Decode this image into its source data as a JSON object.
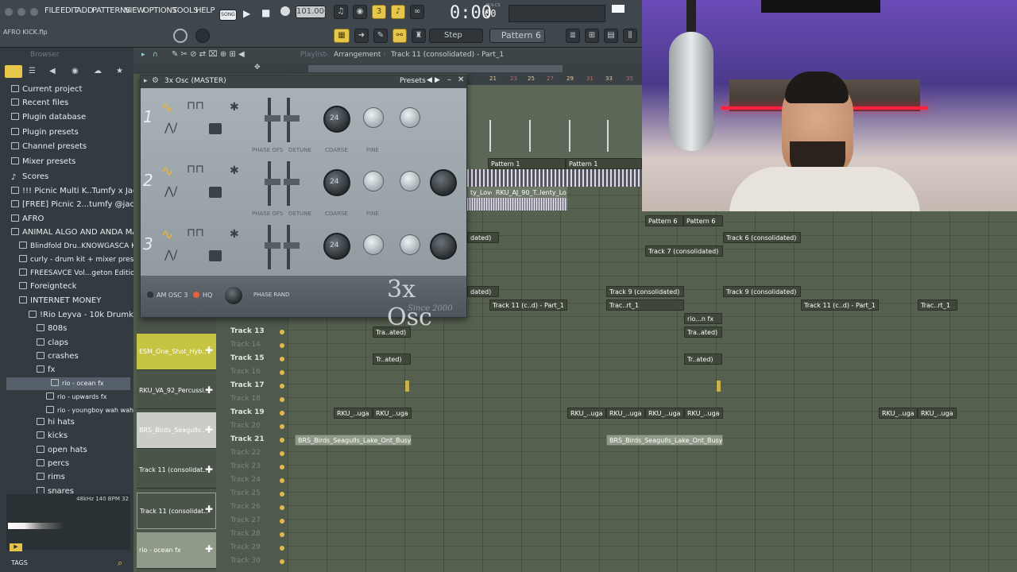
{
  "menu": {
    "items": [
      "FILE",
      "EDIT",
      "ADD",
      "PATTERNS",
      "VIEW",
      "OPTIONS",
      "TOOLS",
      "HELP"
    ],
    "song_label": "SONG",
    "tempo": "101.000",
    "time": "0:00",
    "time_sub": "00",
    "time_unit": "M:S:CS",
    "step_label": "Step",
    "pattern_label": "Pattern 6",
    "hint": "AFRO KICK.flp"
  },
  "browser": {
    "label": "Browser",
    "items": [
      {
        "label": "Current project"
      },
      {
        "label": "Recent files"
      },
      {
        "label": "Plugin database"
      },
      {
        "label": "Plugin presets"
      },
      {
        "label": "Channel presets"
      },
      {
        "label": "Mixer presets"
      },
      {
        "label": "Scores"
      },
      {
        "label": "!!! Picnic Multi K..Tumfy x Jacobvj)"
      },
      {
        "label": "[FREE] Picnic 2...tumfy @jacobvj1)"
      },
      {
        "label": "AFRO"
      },
      {
        "label": "ANIMAL ALGO AND ANDA MAL"
      },
      {
        "label": "Blindfold Dru..KNOWGASCA KIT"
      },
      {
        "label": "curly - drum kit + mixer presets"
      },
      {
        "label": "FREESAVCE Vol...geton Edition)"
      },
      {
        "label": "Foreignteck"
      },
      {
        "label": "INTERNET MONEY"
      },
      {
        "label": "!Rio Leyva - 10k Drumkit"
      },
      {
        "label": "808s"
      },
      {
        "label": "claps"
      },
      {
        "label": "crashes"
      },
      {
        "label": "fx"
      },
      {
        "label": "rio - ocean fx"
      },
      {
        "label": "rio - upwards fx"
      },
      {
        "label": "rio - youngboy wah wah fx"
      },
      {
        "label": "hi hats"
      },
      {
        "label": "kicks"
      },
      {
        "label": "open hats"
      },
      {
        "label": "percs"
      },
      {
        "label": "rims"
      },
      {
        "label": "snares"
      }
    ],
    "sample_info": "48kHz 140 BPM 32",
    "tags": "TAGS"
  },
  "playlist": {
    "title": "Playlist",
    "breadcrumb": "Arrangement",
    "sep": "›",
    "current": "Track 11 (consolidated) - Part_1",
    "ruler": [
      "19",
      "21",
      "23",
      "25",
      "27",
      "29",
      "31",
      "33",
      "35"
    ],
    "tracks": [
      "Track 13",
      "Track 14",
      "Track 15",
      "Track 16",
      "Track 17",
      "Track 18",
      "Track 19",
      "Track 20",
      "Track 21",
      "Track 22",
      "Track 23",
      "Track 24",
      "Track 25",
      "Track 26",
      "Track 27",
      "Track 28",
      "Track 29",
      "Track 30"
    ],
    "channels": [
      "ESM_One_Shot_Hyb..",
      "RKU_VA_92_Percussi..",
      "BRS_Birds_Seagulls..",
      "Track 11 (consolidat..",
      "Track 11 (consolidat..",
      "rio - ocean fx"
    ],
    "clips": {
      "pattern1": "Pattern 1",
      "pattern6": "Pattern 6",
      "dated": "dated)",
      "track6": "Track 6 (consolidated)",
      "track7": "Track 7 (consolidated)",
      "track9": "Track 9 (consolidated)",
      "track11cd": "Track 11 (c..d) - Part_1",
      "tracrt": "Trac..rt_1",
      "rioofx": "rio...n fx",
      "traated": "Tra..ated)",
      "trated": "Tr..ated)",
      "rku": "RKU_..uga",
      "brs": "BRS_Birds_Seagulls_Lake_Ont_Busy",
      "love1": "ty_Love",
      "love2": "RKU_AJ_90_T..lenty_Love"
    }
  },
  "osc": {
    "title": "3x Osc (MASTER)",
    "presets": "Presets",
    "name": "3x Osc",
    "since": "Since 2000",
    "numbers": [
      "1",
      "2",
      "3"
    ],
    "phase_ofs": "PHASE OFS",
    "detune": "DETUNE",
    "coarse": "COARSE",
    "fine": "FINE",
    "knob_val": "24",
    "am": "AM OSC 3",
    "hq": "HQ",
    "phase_rand": "PHASE RAND"
  }
}
